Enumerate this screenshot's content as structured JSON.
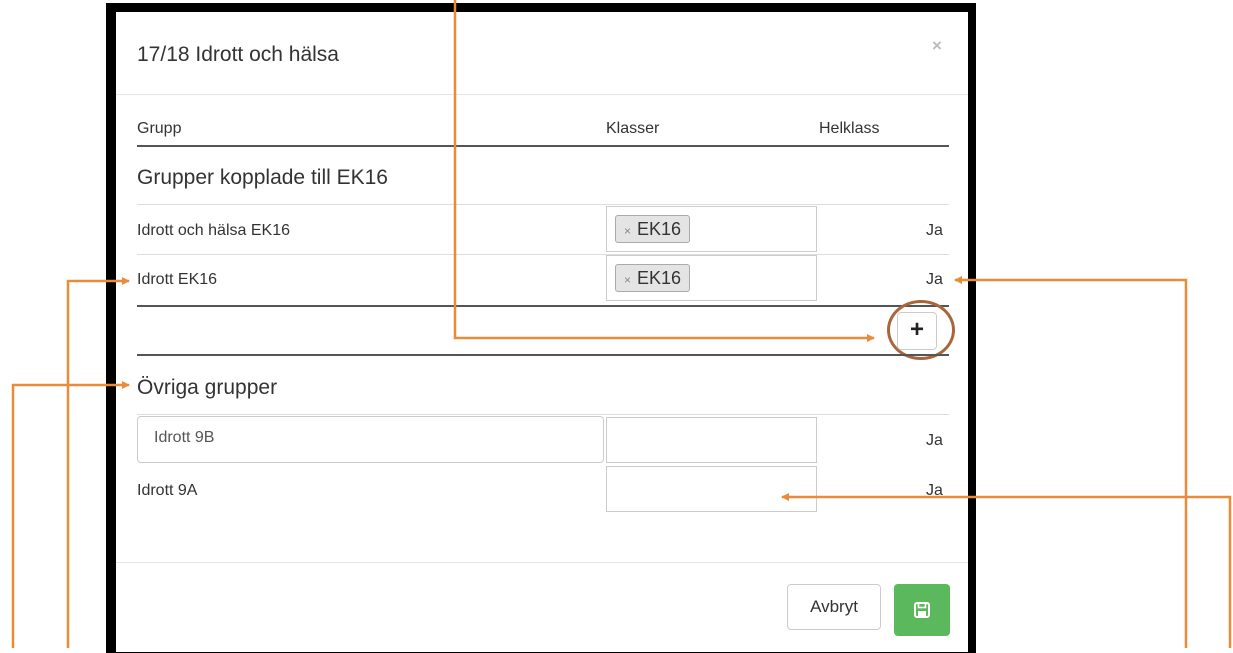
{
  "modal": {
    "title": "17/18 Idrott och hälsa",
    "close_label": "×"
  },
  "table": {
    "headers": {
      "group": "Grupp",
      "classes": "Klasser",
      "whole_class": "Helklass"
    }
  },
  "linked_section": {
    "title": "Grupper kopplade till EK16",
    "rows": [
      {
        "name": "Idrott och hälsa EK16",
        "tag": "EK16",
        "tag_remove": "×",
        "whole_class": "Ja"
      },
      {
        "name": "Idrott EK16",
        "tag": "EK16",
        "tag_remove": "×",
        "whole_class": "Ja"
      }
    ],
    "add_label": "+"
  },
  "other_section": {
    "title": "Övriga grupper",
    "rows": [
      {
        "name": "Idrott 9B",
        "whole_class": "Ja"
      },
      {
        "name": "Idrott 9A",
        "whole_class": "Ja"
      }
    ]
  },
  "footer": {
    "cancel_label": "Avbryt",
    "save_icon": "floppy-disk-icon"
  },
  "colors": {
    "annotation_arrow": "#e98b39",
    "save_button": "#5cb85c",
    "highlight_ring": "#a9663a"
  }
}
